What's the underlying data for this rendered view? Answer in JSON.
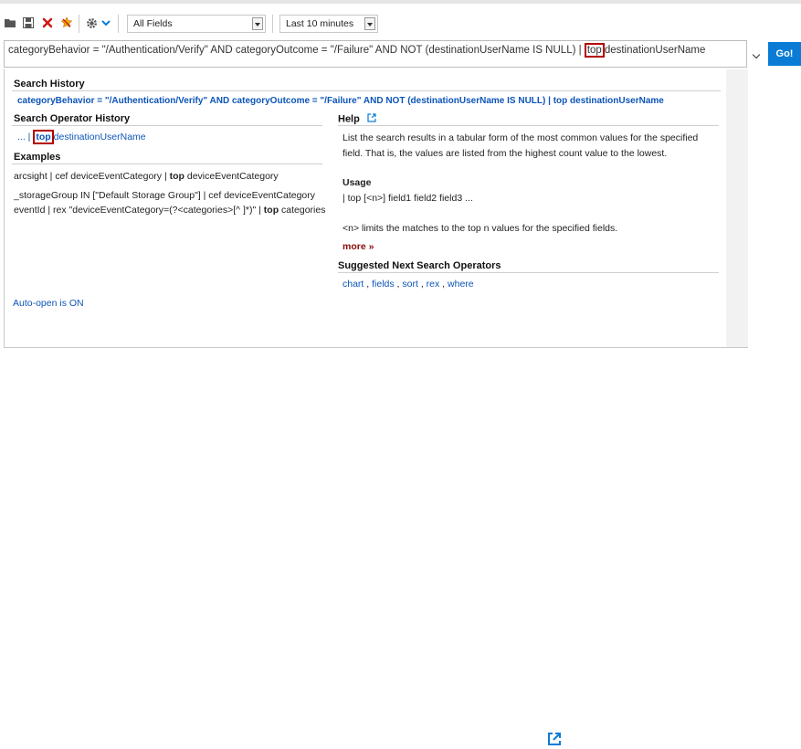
{
  "toolbar": {
    "icons": [
      "folder-open-icon",
      "save-icon",
      "delete-icon",
      "clear-icon",
      "settings-icon",
      "chevron-down-icon"
    ],
    "fields_select": "All Fields",
    "time_select": "Last 10 minutes"
  },
  "query": {
    "before": "categoryBehavior = \"/Authentication/Verify\" AND categoryOutcome = \"/Failure\" AND NOT (destinationUserName IS NULL) |",
    "highlight": "top",
    "after": "destinationUserName",
    "go_label": "Go!"
  },
  "search_history": {
    "title": "Search History",
    "item": "categoryBehavior = \"/Authentication/Verify\" AND categoryOutcome = \"/Failure\" AND NOT (destinationUserName IS NULL) | top destinationUserName"
  },
  "operator_history": {
    "title": "Search Operator History",
    "prefix": "... |",
    "highlight": "top",
    "after": "destinationUserName"
  },
  "examples": {
    "title": "Examples",
    "items": [
      {
        "before": "arcsight | cef deviceEventCategory | ",
        "op": "top",
        "after": " deviceEventCategory"
      },
      {
        "before": "_storageGroup IN [\"Default Storage Group\"] | cef deviceEventCategory",
        "op": "",
        "after": ""
      },
      {
        "before": "eventId | rex \"deviceEventCategory=(?<categories>[^ ]*)\" | ",
        "op": "top",
        "after": " categories"
      }
    ]
  },
  "help": {
    "title": "Help",
    "description_line1": "List the search results in a tabular form of the most common values for the specified",
    "description_line2": "field. That is, the values are listed from the highest count value to the lowest.",
    "usage_title": "Usage",
    "usage": "| top [<n>] field1 field2 field3 ...",
    "n_desc": "<n> limits the matches to the top n values for the specified fields.",
    "more_label": "more »",
    "suggested_title": "Suggested Next Search Operators",
    "suggested": [
      "chart",
      "fields",
      "sort",
      "rex",
      "where"
    ]
  },
  "auto_open": "Auto-open is ON",
  "colors": {
    "accent": "#0a7cd6",
    "link": "#0d55b8",
    "highlight_border": "#b40000",
    "more": "#8c0a0a"
  }
}
